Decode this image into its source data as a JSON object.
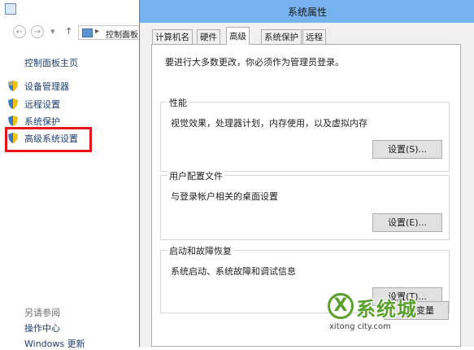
{
  "control_panel": {
    "breadcrumb": "控制面板",
    "nav": {
      "back": "←",
      "forward": "→",
      "dropdown": "▾",
      "up": "↑",
      "separator": "▸"
    },
    "home_link": "控制面板主页",
    "items": [
      {
        "label": "设备管理器"
      },
      {
        "label": "远程设置"
      },
      {
        "label": "系统保护"
      },
      {
        "label": "高级系统设置"
      }
    ],
    "see_also": {
      "heading": "另请参阅",
      "links": [
        "操作中心",
        "Windows 更新"
      ]
    }
  },
  "dialog": {
    "title": "系统属性",
    "tabs": [
      "计算机名",
      "硬件",
      "高级",
      "系统保护",
      "远程"
    ],
    "active_tab": "高级",
    "admin_notice": "要进行大多数更改，你必须作为管理员登录。",
    "groups": [
      {
        "title": "性能",
        "description": "视觉效果，处理器计划，内存使用，以及虚拟内存",
        "button": "设置(S)..."
      },
      {
        "title": "用户配置文件",
        "description": "与登录帐户相关的桌面设置",
        "button": "设置(E)..."
      },
      {
        "title": "启动和故障恢复",
        "description": "系统启动、系统故障和调试信息",
        "button": "设置(T)..."
      }
    ],
    "ok_button": "环境变量"
  },
  "watermark": {
    "name": "系统城",
    "url": "xitong city.com"
  },
  "colors": {
    "highlight": "#e8141b",
    "dialog_titlebar": "#77b3ef",
    "link": "#1e3e6e",
    "watermark": "#5aa02c"
  }
}
